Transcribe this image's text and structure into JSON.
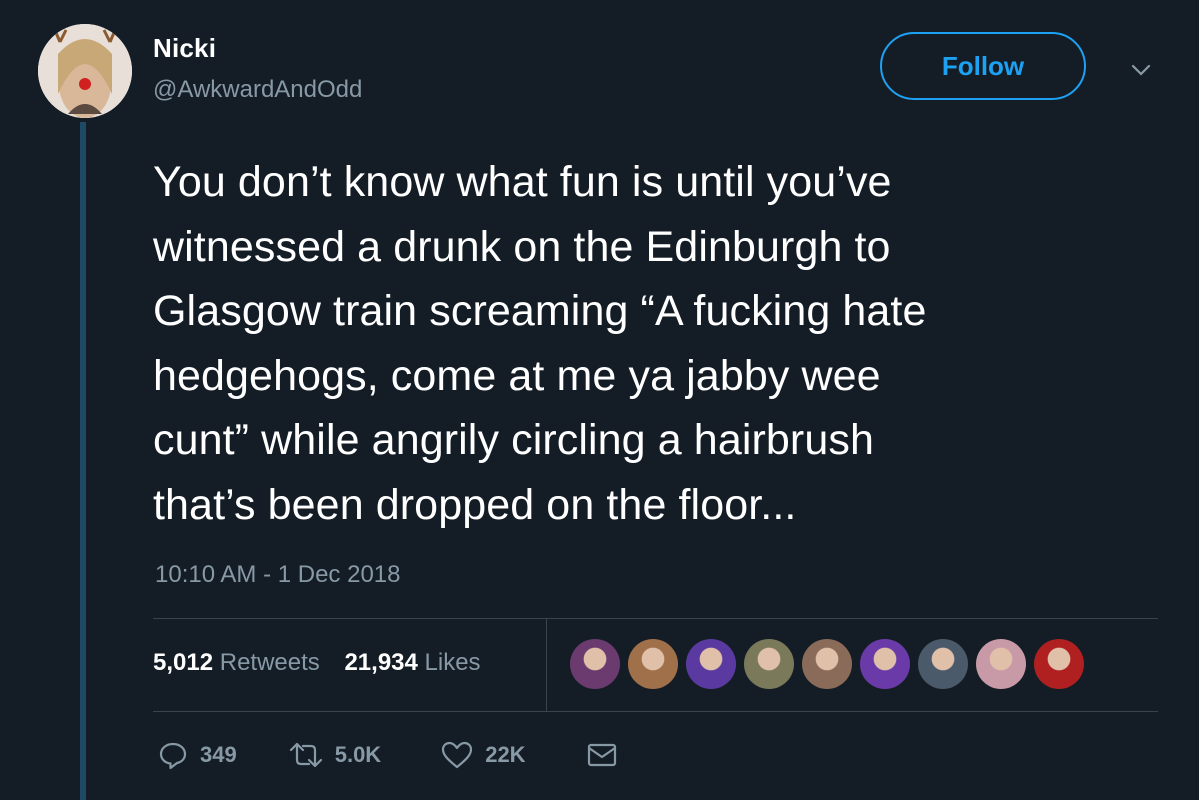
{
  "user": {
    "name": "Nicki",
    "handle": "@AwkwardAndOdd"
  },
  "follow_label": "Follow",
  "tweet": {
    "text": "You don’t know what fun is until you’ve\nwitnessed a drunk on the Edinburgh to\nGlasgow train screaming “A fucking hate\nhedgehogs, come at me ya jabby wee\ncunt” while angrily circling a hairbrush\nthat’s been dropped on the floor...",
    "timestamp": "10:10 AM - 1 Dec 2018"
  },
  "stats": {
    "retweets_count": "5,012",
    "retweets_label": "Retweets",
    "likes_count": "21,934",
    "likes_label": "Likes"
  },
  "likers": [
    {
      "color": "#6b3a6e"
    },
    {
      "color": "#a0704a"
    },
    {
      "color": "#5a3aa0"
    },
    {
      "color": "#7a7a5a"
    },
    {
      "color": "#8a6a58"
    },
    {
      "color": "#6a3aa8"
    },
    {
      "color": "#4a5a6a"
    },
    {
      "color": "#c89aa8"
    },
    {
      "color": "#b02020"
    }
  ],
  "actions": {
    "replies": "349",
    "retweets": "5.0K",
    "likes": "22K"
  },
  "icons": [
    "reply-icon",
    "retweet-icon",
    "like-icon",
    "message-icon",
    "chevron-down-icon"
  ],
  "colors": {
    "background": "#141d26",
    "accent": "#1da1f2",
    "muted": "#8899a6"
  }
}
